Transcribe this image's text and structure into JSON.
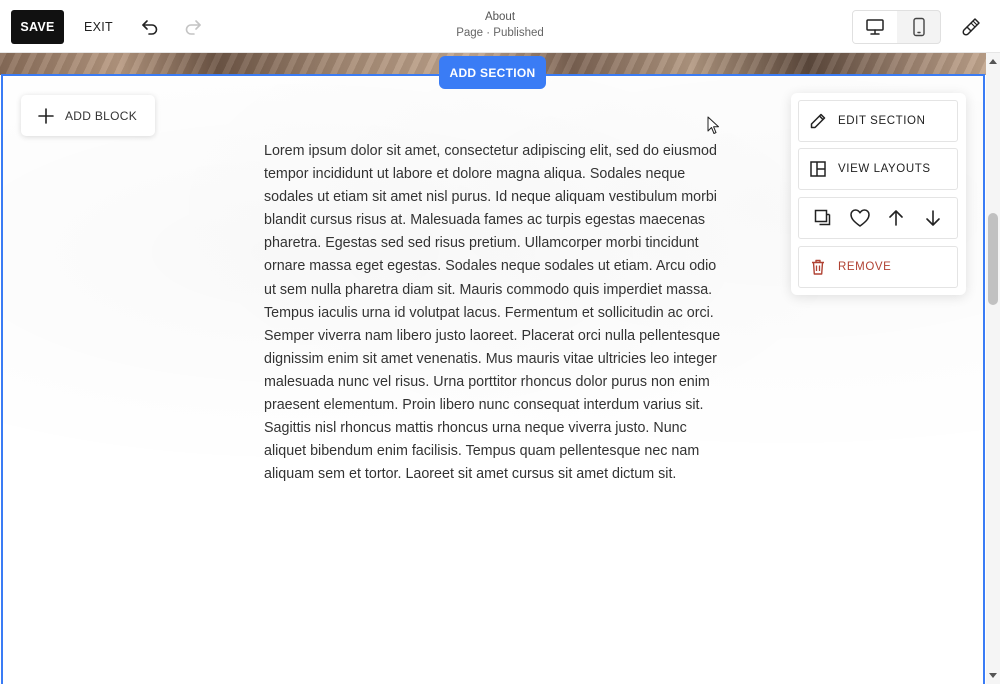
{
  "toolbar": {
    "save_label": "SAVE",
    "exit_label": "EXIT",
    "undo_icon": "undo-icon",
    "redo_icon": "redo-icon"
  },
  "page": {
    "title": "About",
    "subtitle": "Page · Published"
  },
  "view": {
    "desktop_icon": "desktop-icon",
    "mobile_icon": "mobile-icon",
    "selected": "desktop",
    "design_icon": "paintbrush-icon"
  },
  "section": {
    "add_section_label": "ADD SECTION",
    "add_block_label": "ADD BLOCK",
    "body_text": "Lorem ipsum dolor sit amet, consectetur adipiscing elit, sed do eiusmod tempor incididunt ut labore et dolore magna aliqua. Sodales neque sodales ut etiam sit amet nisl purus. Id neque aliquam vestibulum morbi blandit cursus risus at. Malesuada fames ac turpis egestas maecenas pharetra. Egestas sed sed risus pretium. Ullamcorper morbi tincidunt ornare massa eget egestas. Sodales neque sodales ut etiam. Arcu odio ut sem nulla pharetra diam sit. Mauris commodo quis imperdiet massa. Tempus iaculis urna id volutpat lacus. Fermentum et sollicitudin ac orci. Semper viverra nam libero justo laoreet. Placerat orci nulla pellentesque dignissim enim sit amet venenatis. Mus mauris vitae ultricies leo integer malesuada nunc vel risus. Urna porttitor rhoncus dolor purus non enim praesent elementum. Proin libero nunc consequat interdum varius sit. Sagittis nisl rhoncus mattis rhoncus urna neque viverra justo. Nunc aliquet bibendum enim facilisis. Tempus quam pellentesque nec nam aliquam sem et tortor. Laoreet sit amet cursus sit amet dictum sit."
  },
  "section_panel": {
    "edit_label": "EDIT SECTION",
    "layouts_label": "VIEW LAYOUTS",
    "remove_label": "REMOVE",
    "icons": [
      "duplicate-icon",
      "heart-icon",
      "arrow-up-icon",
      "arrow-down-icon"
    ]
  },
  "colors": {
    "accent": "#3a7cf5",
    "save_bg": "#111111",
    "remove": "#b04233"
  }
}
